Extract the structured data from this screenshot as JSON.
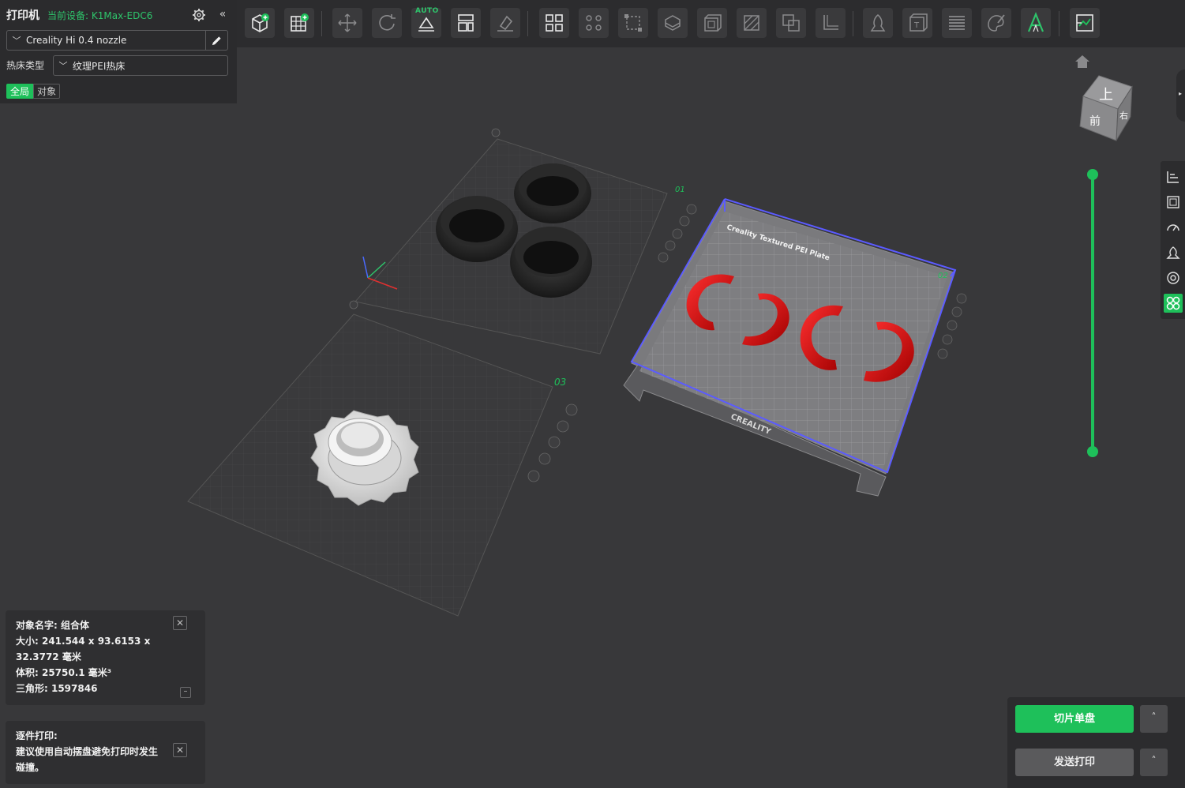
{
  "printer": {
    "title": "打印机",
    "current_device": "当前设备: K1Max-EDC6",
    "collapse_glyph": "«",
    "nozzle": "Creality Hi 0.4 nozzle",
    "bed_label": "热床类型",
    "bed_type": "纹理PEI热床",
    "scope_tabs": [
      "全局",
      "对象"
    ]
  },
  "toolbar": {
    "auto_tag": "AUTO",
    "icons": [
      "add-cube-icon",
      "grid-plate-icon",
      "move-icon",
      "rotate-icon",
      "auto-orient-icon",
      "arrange-icon",
      "lay-flat-icon",
      "split-objects-icon",
      "split-parts-icon",
      "scale-icon",
      "cut-icon",
      "hollow-icon",
      "support-paint-icon",
      "boolean-icon",
      "measure-icon",
      "seam-paint-icon",
      "emboss-icon",
      "layers-icon",
      "color-paint-icon",
      "text-icon",
      "assemble-icon"
    ]
  },
  "plates": {
    "plate1_num": "01",
    "plate2_num": "02",
    "plate3_num": "03",
    "plate2_label": "Creality Textured PEI Plate",
    "plate2_brand": "CREALITY"
  },
  "view_cube": {
    "top": "上",
    "front": "前",
    "right": "右"
  },
  "side_toolbar": [
    "align-icon",
    "plate-icon",
    "speed-icon",
    "support-icon",
    "cooling-icon",
    "multi-color-icon"
  ],
  "object_info": {
    "name": "对象名字: 组合体",
    "size_1": "大小:   241.544 x 93.6153 x",
    "size_2": "32.3772 毫米",
    "volume": "体积:   25750.1 毫米³",
    "triangles": "三角形:  1597846",
    "close_glyph": "✕",
    "minimize_glyph": "–"
  },
  "notice": {
    "title": "逐件打印:",
    "line1": "建议使用自动摆盘避免打印时发生",
    "line2": "碰撞。",
    "close_glyph": "✕"
  },
  "actions": {
    "slice": "切片单盘",
    "send": "发送打印",
    "caret": "˄"
  },
  "colors": {
    "accent": "#1ec05a",
    "device_text": "#2ec46b",
    "model_red": "#d81010",
    "build_box": "#5b5bff"
  }
}
